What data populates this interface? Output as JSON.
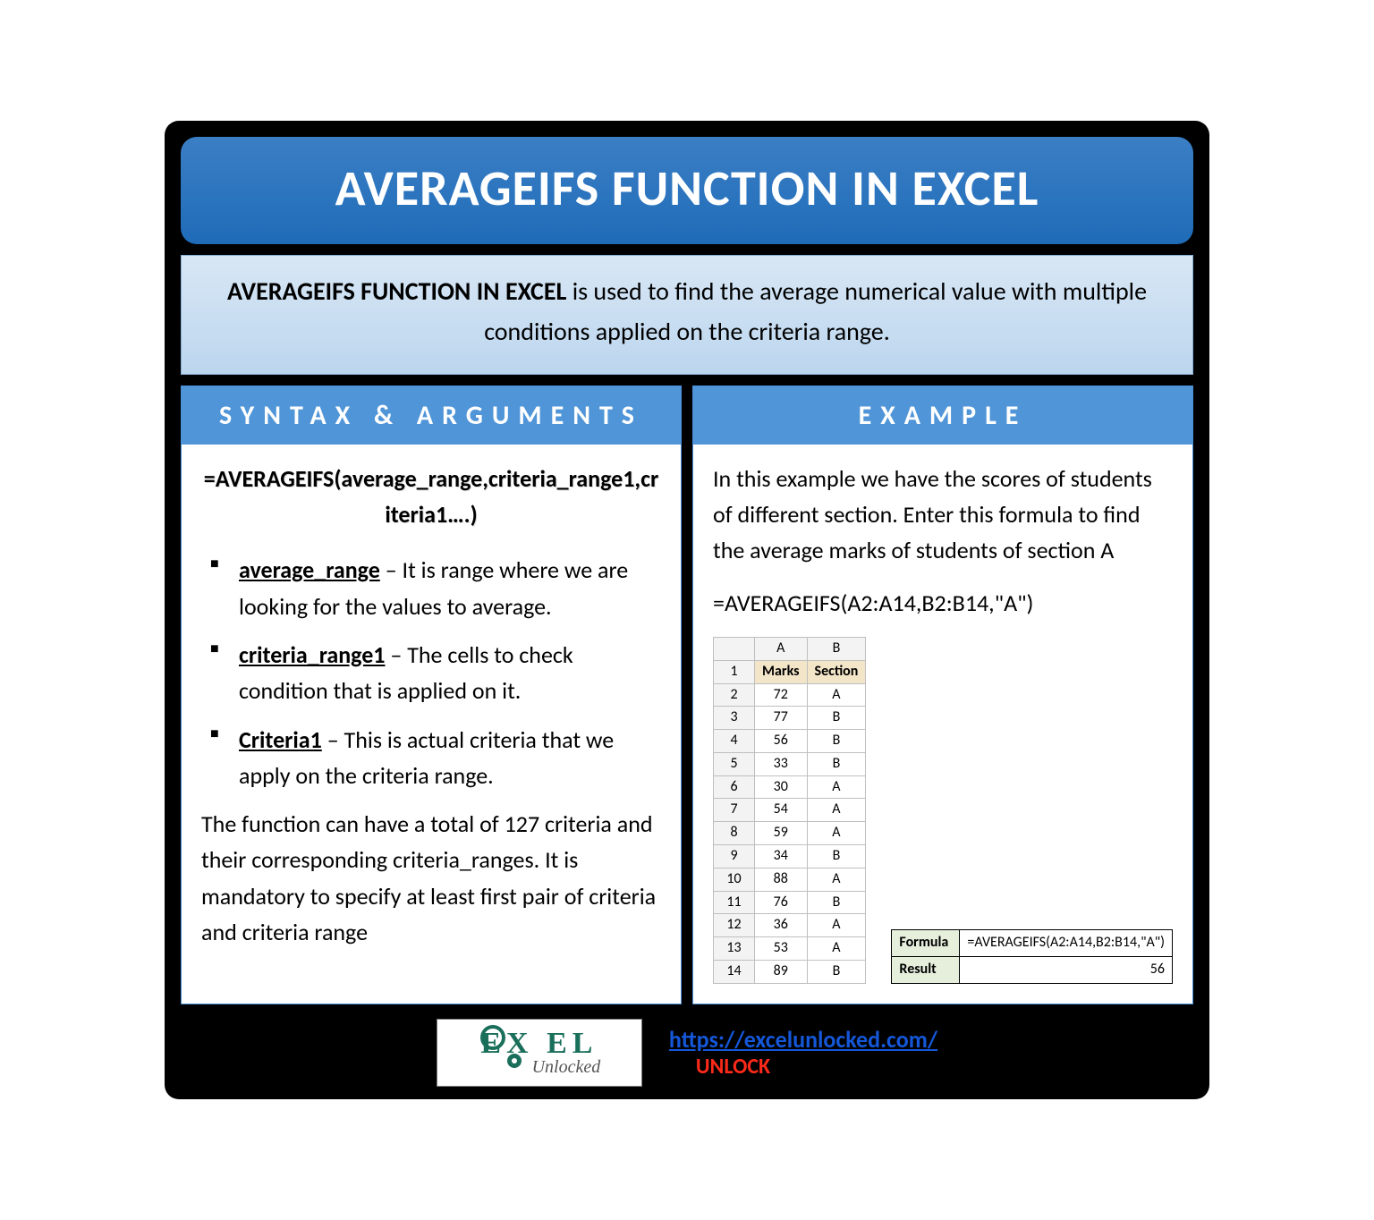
{
  "title": "AVERAGEIFS FUNCTION IN EXCEL",
  "description": {
    "lead": "AVERAGEIFS FUNCTION IN EXCEL",
    "rest": " is used to find the average numerical value with multiple conditions applied on the criteria range."
  },
  "syntax": {
    "header": "SYNTAX & ARGUMENTS",
    "formula": "=AVERAGEIFS(average_range,criteria_range1,criteria1….)",
    "args": [
      {
        "name": "average_range",
        "desc": " – It is range where we are looking for the values to average."
      },
      {
        "name": "criteria_range1",
        "desc": " – The cells to check condition that is applied on it."
      },
      {
        "name": "Criteria1",
        "desc": " – This is actual criteria that we apply on the criteria range."
      }
    ],
    "note": "The function can have a total of 127 criteria and their corresponding criteria_ranges. It is mandatory to specify at least first pair of criteria and criteria range"
  },
  "example": {
    "header": "EXAMPLE",
    "intro": "In this example we have the scores of students of different section. Enter this formula to find the average marks of students of section A",
    "formula": "=AVERAGEIFS(A2:A14,B2:B14,\"A\")",
    "sheet": {
      "colA": "A",
      "colB": "B",
      "headers": {
        "marks": "Marks",
        "section": "Section"
      },
      "rows": [
        {
          "n": "2",
          "marks": "72",
          "section": "A"
        },
        {
          "n": "3",
          "marks": "77",
          "section": "B"
        },
        {
          "n": "4",
          "marks": "56",
          "section": "B"
        },
        {
          "n": "5",
          "marks": "33",
          "section": "B"
        },
        {
          "n": "6",
          "marks": "30",
          "section": "A"
        },
        {
          "n": "7",
          "marks": "54",
          "section": "A"
        },
        {
          "n": "8",
          "marks": "59",
          "section": "A"
        },
        {
          "n": "9",
          "marks": "34",
          "section": "B"
        },
        {
          "n": "10",
          "marks": "88",
          "section": "A"
        },
        {
          "n": "11",
          "marks": "76",
          "section": "B"
        },
        {
          "n": "12",
          "marks": "36",
          "section": "A"
        },
        {
          "n": "13",
          "marks": "53",
          "section": "A"
        },
        {
          "n": "14",
          "marks": "89",
          "section": "B"
        }
      ]
    },
    "result": {
      "formula_label": "Formula",
      "formula_value": "=AVERAGEIFS(A2:A14,B2:B14,\"A\")",
      "result_label": "Result",
      "result_value": "56"
    }
  },
  "footer": {
    "logo_top": "EX  EL",
    "logo_sub": "Unlocked",
    "url": "https://excelunlocked.com/",
    "unlock": "UNLOCK"
  }
}
